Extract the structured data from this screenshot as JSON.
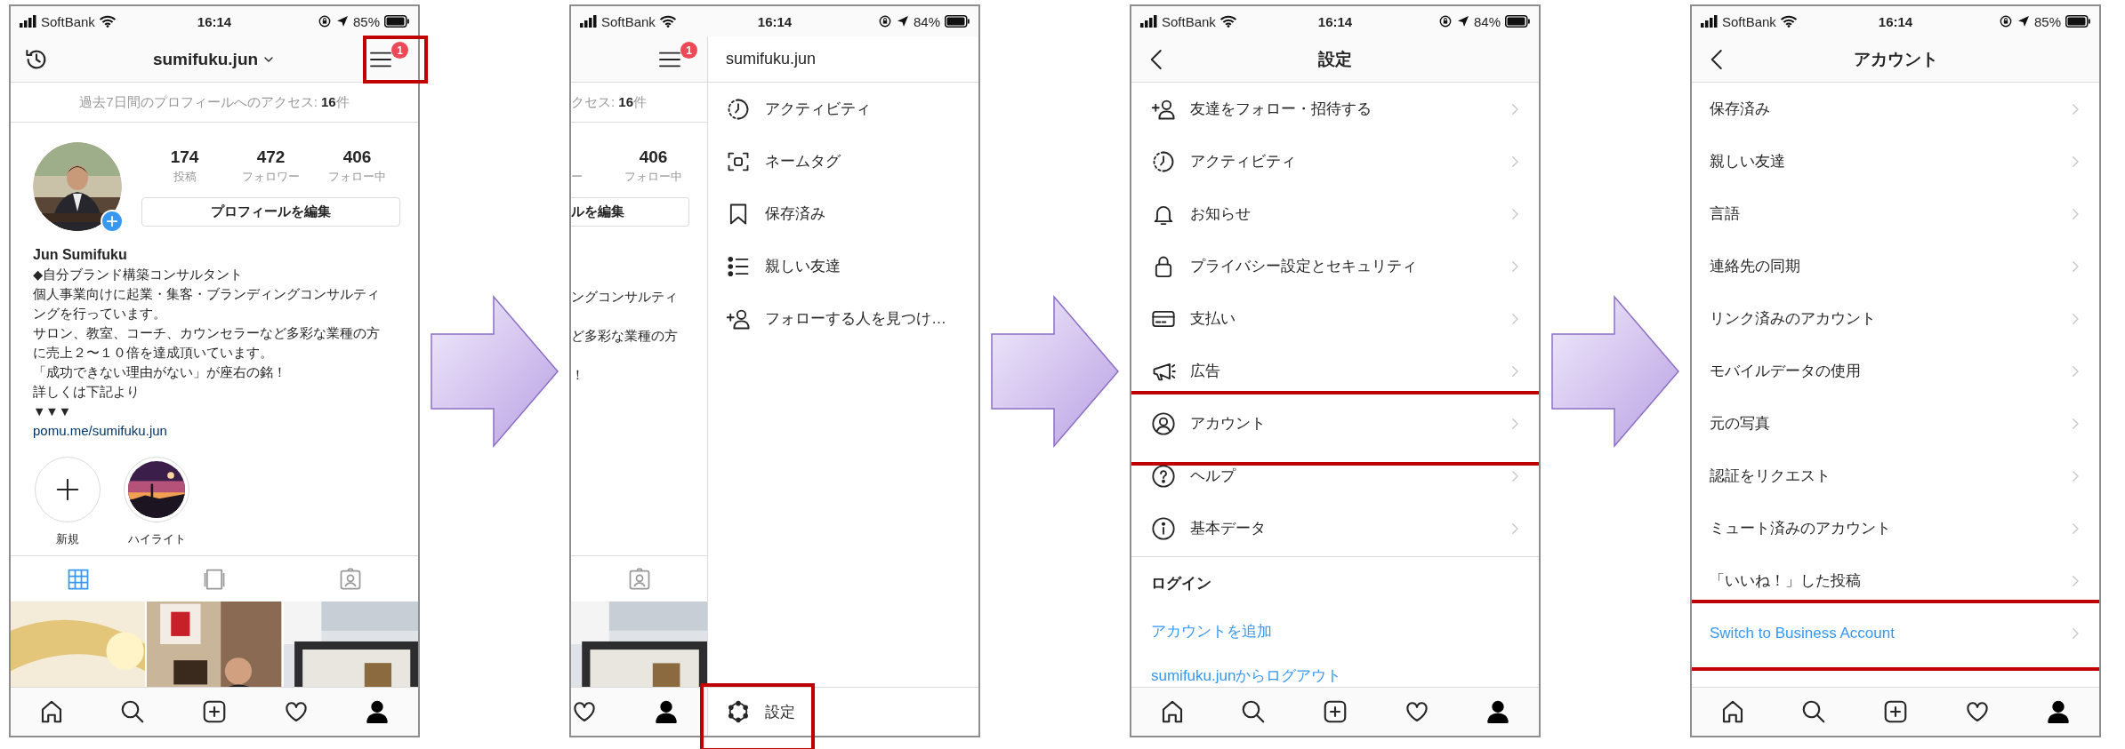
{
  "screens": [
    {
      "kind": "profile",
      "status": {
        "carrier": "SoftBank",
        "time": "16:14",
        "battery": "85%"
      },
      "header": {
        "username": "sumifuku.jun",
        "badge": "1",
        "highlighted": true
      },
      "access": "過去7日間のプロフィールへのアクセス: **16**件",
      "stats": [
        {
          "value": "174",
          "label": "投稿"
        },
        {
          "value": "472",
          "label": "フォロワー"
        },
        {
          "value": "406",
          "label": "フォロー中"
        }
      ],
      "edit_button": "プロフィールを編集",
      "name": "Jun Sumifuku",
      "bio": [
        "◆自分ブランド構築コンサルタント",
        "個人事業向けに起業・集客・ブランディングコンサルティ",
        "ングを行っています。",
        "サロン、教室、コーチ、カウンセラーなど多彩な業種の方",
        "に売上２〜１０倍を達成頂いています。",
        "「成功できない理由がない」が座右の銘！",
        "詳しくは下記より",
        "▼▼▼"
      ],
      "link": "pomu.me/sumifuku.jun",
      "highlights": [
        {
          "kind": "new",
          "label": "新規"
        },
        {
          "kind": "picture",
          "label": "ハイライト"
        }
      ],
      "tabs": [
        {
          "kind": "grid",
          "selected": true
        },
        {
          "kind": "feed",
          "selected": false
        },
        {
          "kind": "tagged",
          "selected": false
        }
      ],
      "posts": [
        {
          "kind": "picture"
        },
        {
          "kind": "picture"
        },
        {
          "kind": "picture"
        }
      ],
      "nav": [
        {
          "kind": "home",
          "selected": false
        },
        {
          "kind": "search",
          "selected": false
        },
        {
          "kind": "add",
          "selected": false
        },
        {
          "kind": "heart",
          "selected": false
        },
        {
          "kind": "profile",
          "selected": true
        }
      ]
    },
    {
      "kind": "drawer",
      "status": {
        "carrier": "SoftBank",
        "time": "16:14",
        "battery": "84%"
      },
      "behind": {
        "badge": "1",
        "access": "クセス: **16**件",
        "cut_label": "ー",
        "stat": {
          "value": "406",
          "label": "フォロー中"
        },
        "edit_button": "ルを編集",
        "bio": [
          "ングコンサルティ",
          "ど多彩な業種の方",
          "！"
        ],
        "tabs": [
          {
            "kind": "tagged",
            "selected": false
          }
        ],
        "posts": [
          {
            "kind": "picture"
          }
        ],
        "nav": [
          {
            "kind": "heart",
            "selected": false
          },
          {
            "kind": "profile",
            "selected": true
          }
        ]
      },
      "drawer": {
        "username": "sumifuku.jun",
        "items": [
          {
            "kind": "activity",
            "label": "アクティビティ"
          },
          {
            "kind": "nametag",
            "label": "ネームタグ"
          },
          {
            "kind": "bookmark",
            "label": "保存済み"
          },
          {
            "kind": "starlist",
            "label": "親しい友達"
          },
          {
            "kind": "addperson",
            "label": "フォローする人を見つけ…"
          }
        ],
        "footer": {
          "label": "設定",
          "highlighted": true
        }
      }
    },
    {
      "kind": "settings",
      "status": {
        "carrier": "SoftBank",
        "time": "16:14",
        "battery": "84%"
      },
      "title": "設定",
      "items": [
        {
          "kind": "addperson",
          "label": "友達をフォロー・招待する",
          "highlighted": false
        },
        {
          "kind": "activity",
          "label": "アクティビティ",
          "highlighted": false
        },
        {
          "kind": "bell",
          "label": "お知らせ",
          "highlighted": false
        },
        {
          "kind": "lock",
          "label": "プライバシー設定とセキュリティ",
          "highlighted": false
        },
        {
          "kind": "card",
          "label": "支払い",
          "highlighted": false
        },
        {
          "kind": "megaphone",
          "label": "広告",
          "highlighted": false
        },
        {
          "kind": "account",
          "label": "アカウント",
          "highlighted": true
        },
        {
          "kind": "help",
          "label": "ヘルプ",
          "highlighted": false
        },
        {
          "kind": "info",
          "label": "基本データ",
          "highlighted": false
        }
      ],
      "section": "ログイン",
      "links": [
        "アカウントを追加",
        "sumifuku.junからログアウト"
      ],
      "nav": [
        {
          "kind": "home",
          "selected": false
        },
        {
          "kind": "search",
          "selected": false
        },
        {
          "kind": "add",
          "selected": false
        },
        {
          "kind": "heart",
          "selected": false
        },
        {
          "kind": "profile",
          "selected": true
        }
      ]
    },
    {
      "kind": "account",
      "status": {
        "carrier": "SoftBank",
        "time": "16:14",
        "battery": "85%"
      },
      "title": "アカウント",
      "items": [
        {
          "kind": "plain",
          "label": "保存済み",
          "highlighted": false
        },
        {
          "kind": "plain",
          "label": "親しい友達",
          "highlighted": false
        },
        {
          "kind": "plain",
          "label": "言語",
          "highlighted": false
        },
        {
          "kind": "plain",
          "label": "連絡先の同期",
          "highlighted": false
        },
        {
          "kind": "plain",
          "label": "リンク済みのアカウント",
          "highlighted": false
        },
        {
          "kind": "plain",
          "label": "モバイルデータの使用",
          "highlighted": false
        },
        {
          "kind": "plain",
          "label": "元の写真",
          "highlighted": false
        },
        {
          "kind": "plain",
          "label": "認証をリクエスト",
          "highlighted": false
        },
        {
          "kind": "plain",
          "label": "ミュート済みのアカウント",
          "highlighted": false
        },
        {
          "kind": "plain",
          "label": "「いいね！」した投稿",
          "highlighted": false
        },
        {
          "kind": "link",
          "label": "Switch to Business Account",
          "highlighted": true
        }
      ],
      "nav": [
        {
          "kind": "home",
          "selected": false
        },
        {
          "kind": "search",
          "selected": false
        },
        {
          "kind": "add",
          "selected": false
        },
        {
          "kind": "heart",
          "selected": false
        },
        {
          "kind": "profile",
          "selected": true
        }
      ]
    }
  ]
}
